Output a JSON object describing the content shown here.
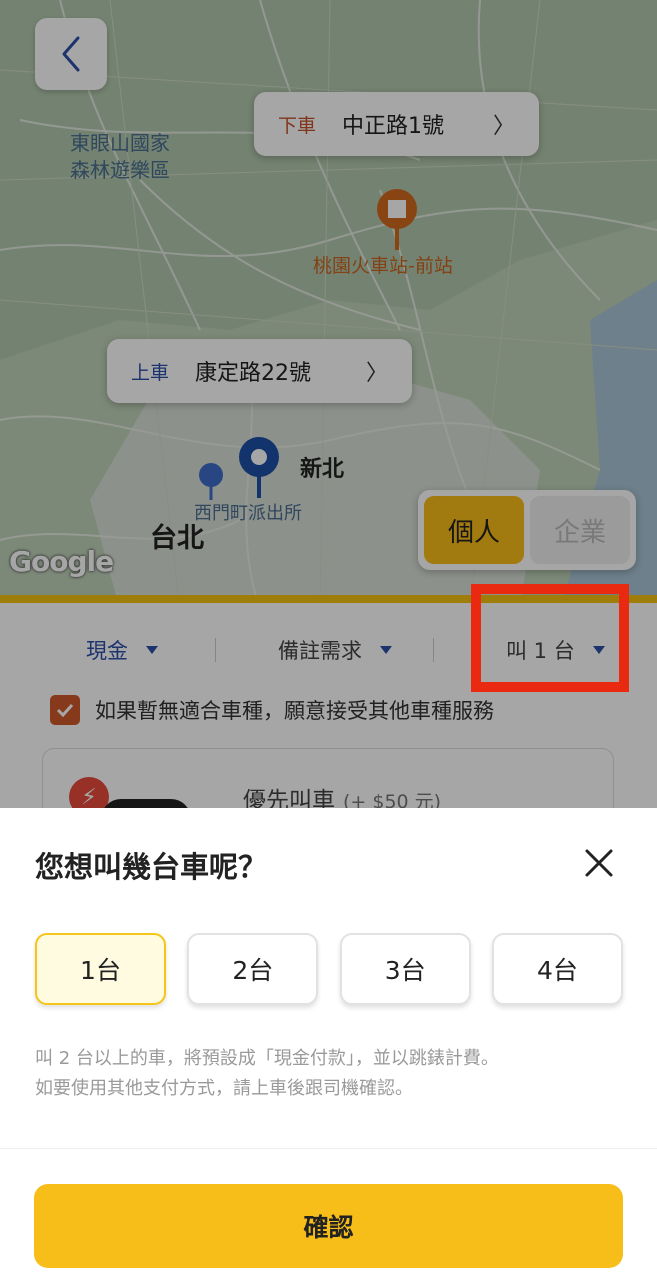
{
  "map": {
    "drop_off": {
      "tag": "下車",
      "address": "中正路1號",
      "chevron": "〉"
    },
    "pick_up": {
      "tag": "上車",
      "address": "康定路22號",
      "chevron": "〉"
    },
    "labels": {
      "park": "東眼山國家\n森林遊樂區",
      "station": "桃園火車站-前站",
      "new_taipei": "新北",
      "ximen": "西門町派出所",
      "taipei": "台北",
      "google": "Google"
    },
    "mode_toggle": {
      "personal": "個人",
      "business": "企業",
      "selected": "personal"
    }
  },
  "options": {
    "payment": "現金",
    "notes": "備註需求",
    "car_count": "叫 1 台",
    "accept_other": "如果暫無適合車種，願意接受其他車種服務",
    "priority": {
      "label": "優先叫車",
      "price": "(+ $50 元)"
    }
  },
  "sheet": {
    "title": "您想叫幾台車呢？",
    "counts": [
      "1台",
      "2台",
      "3台",
      "4台"
    ],
    "selected_index": 0,
    "note_line1": "叫 2 台以上的車，將預設成「現金付款」，並以跳錶計費。",
    "note_line2": "如要使用其他支付方式，請上車後跟司機確認。",
    "confirm": "確認"
  },
  "colors": {
    "accent": "#f7bd19",
    "highlight": "#ea2a10",
    "link_blue": "#2d4fa8",
    "drop_tag": "#c4502a"
  }
}
